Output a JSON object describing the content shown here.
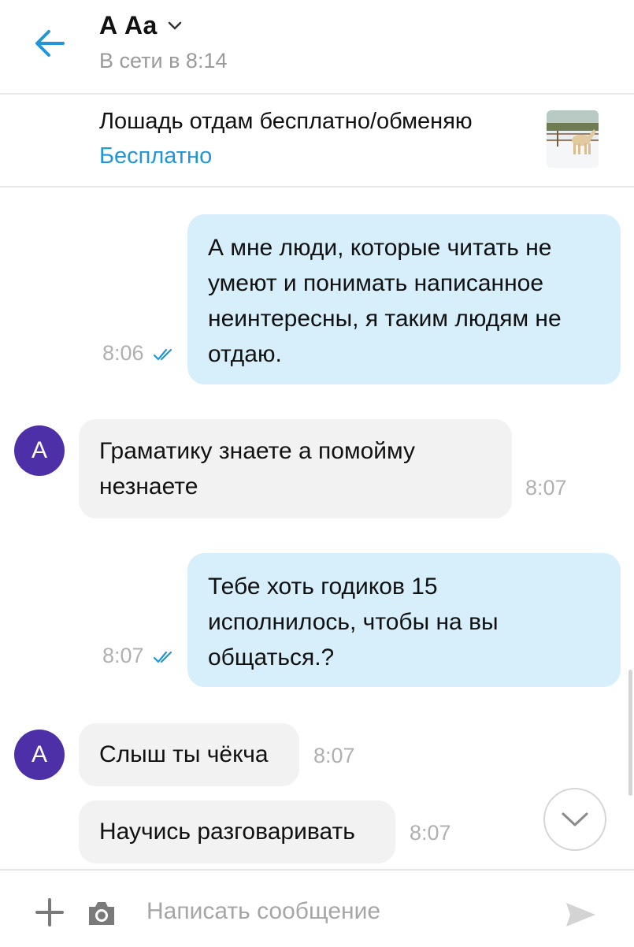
{
  "header": {
    "title": "А Аа",
    "status": "В сети в 8:14"
  },
  "listing": {
    "title": "Лошадь отдам бесплатно/обменяю",
    "price": "Бесплатно"
  },
  "messages": [
    {
      "direction": "outgoing",
      "lines": [
        "А мне люди, которые читать не",
        "умеют и понимать написанное",
        "неинтересны, я таким людям не",
        "отдаю."
      ],
      "time": "8:06",
      "read": true
    },
    {
      "direction": "incoming",
      "avatar": "А",
      "lines": [
        "Граматику знаете а помойму",
        "незнаете"
      ],
      "time": "8:07"
    },
    {
      "direction": "outgoing",
      "lines": [
        "Тебе хоть годиков 15",
        "исполнилось, чтобы на вы",
        "общаться.?"
      ],
      "time": "8:07",
      "read": true
    },
    {
      "direction": "incoming",
      "avatar": "А",
      "lines": [
        "Слыш ты чёкча"
      ],
      "time": "8:07"
    },
    {
      "direction": "incoming",
      "lines": [
        "Научись разговаривать"
      ],
      "time": "8:07"
    }
  ],
  "composer": {
    "placeholder": "Написать сообщение"
  },
  "colors": {
    "accent": "#2196d8",
    "outgoing_bubble": "#d7eefb",
    "incoming_bubble": "#f2f2f2",
    "avatar": "#4d2fa8"
  },
  "icons": [
    "back-arrow-icon",
    "chevron-down-icon",
    "read-checks-icon",
    "scroll-down-icon",
    "plus-icon",
    "camera-icon",
    "send-icon"
  ]
}
